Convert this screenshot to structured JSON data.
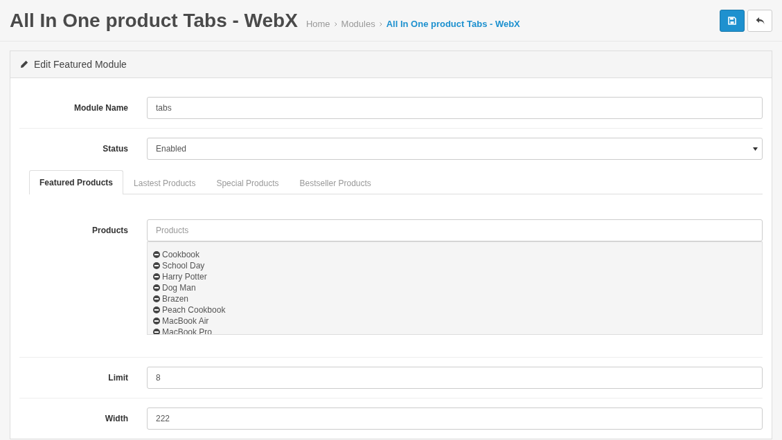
{
  "page": {
    "title": "All In One product Tabs - WebX",
    "breadcrumb": [
      {
        "label": "Home",
        "selected": false
      },
      {
        "label": "Modules",
        "selected": false
      },
      {
        "label": "All In One product Tabs - WebX",
        "selected": true
      }
    ]
  },
  "panel": {
    "heading": "Edit Featured Module"
  },
  "module_name": {
    "label": "Module Name",
    "value": "tabs"
  },
  "status": {
    "label": "Status",
    "value": "Enabled"
  },
  "tabs": [
    {
      "label": "Featured Products",
      "selected": true
    },
    {
      "label": "Lastest Products",
      "selected": false
    },
    {
      "label": "Special Products",
      "selected": false
    },
    {
      "label": "Bestseller Products",
      "selected": false
    }
  ],
  "products": {
    "label": "Products",
    "placeholder": "Products",
    "items": [
      "Cookbook",
      "School Day",
      "Harry Potter",
      "Dog Man",
      "Brazen",
      "Peach Cookbook",
      "MacBook Air",
      "MacBook Pro"
    ]
  },
  "limit": {
    "label": "Limit",
    "value": "8"
  },
  "width": {
    "label": "Width",
    "value": "222"
  }
}
